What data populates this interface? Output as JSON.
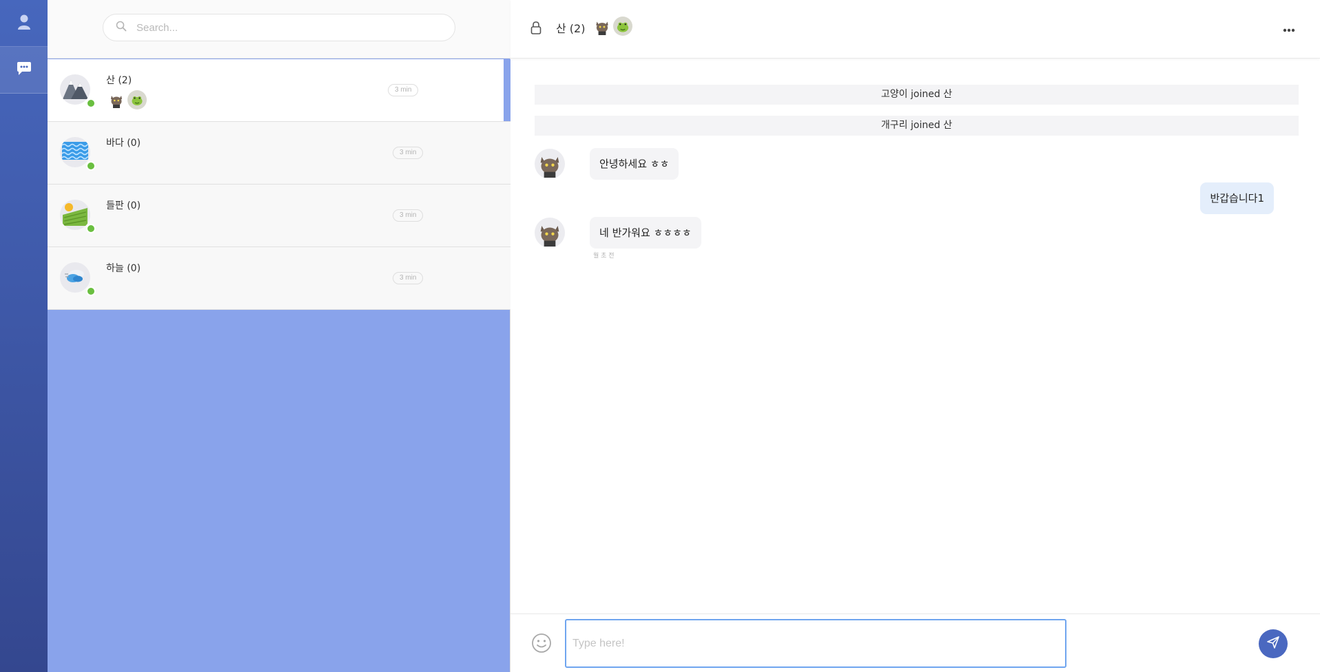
{
  "rail": {
    "items": [
      {
        "icon": "user-icon",
        "active": false
      },
      {
        "icon": "chat-bubble-icon",
        "active": true
      }
    ]
  },
  "search": {
    "placeholder": "Search..."
  },
  "rooms": [
    {
      "name": "산 (2)",
      "time": "3 min",
      "icon": "mountain-icon",
      "members": [
        "cat-avatar",
        "frog-avatar"
      ],
      "active": true
    },
    {
      "name": "바다 (0)",
      "time": "3 min",
      "icon": "sea-icon",
      "members": [],
      "active": false
    },
    {
      "name": "들판 (0)",
      "time": "3 min",
      "icon": "field-icon",
      "members": [],
      "active": false
    },
    {
      "name": "하늘 (0)",
      "time": "3 min",
      "icon": "sky-icon",
      "members": [],
      "active": false
    }
  ],
  "chat": {
    "title": "산 (2)",
    "members": [
      "cat-avatar",
      "frog-avatar"
    ],
    "system_messages": [
      "고양이 joined 산",
      "개구리 joined 산"
    ],
    "messages": [
      {
        "author": "cat",
        "text": "안녕하세요 ㅎㅎ",
        "mine": false
      },
      {
        "author": "me",
        "text": "반갑습니다1",
        "mine": true
      },
      {
        "author": "cat",
        "text": "네 반가워요 ㅎㅎㅎㅎ",
        "mine": false,
        "meta": "월 초 전"
      }
    ]
  },
  "compose": {
    "placeholder": "Type here!"
  },
  "colors": {
    "rail_top": "#4767bd",
    "rail_bottom": "#34478f",
    "list_bg": "#89a3eb",
    "online": "#6abf40",
    "input_border": "#6fa5ef",
    "send": "#4a68c0",
    "my_bubble": "#e4eefb"
  }
}
